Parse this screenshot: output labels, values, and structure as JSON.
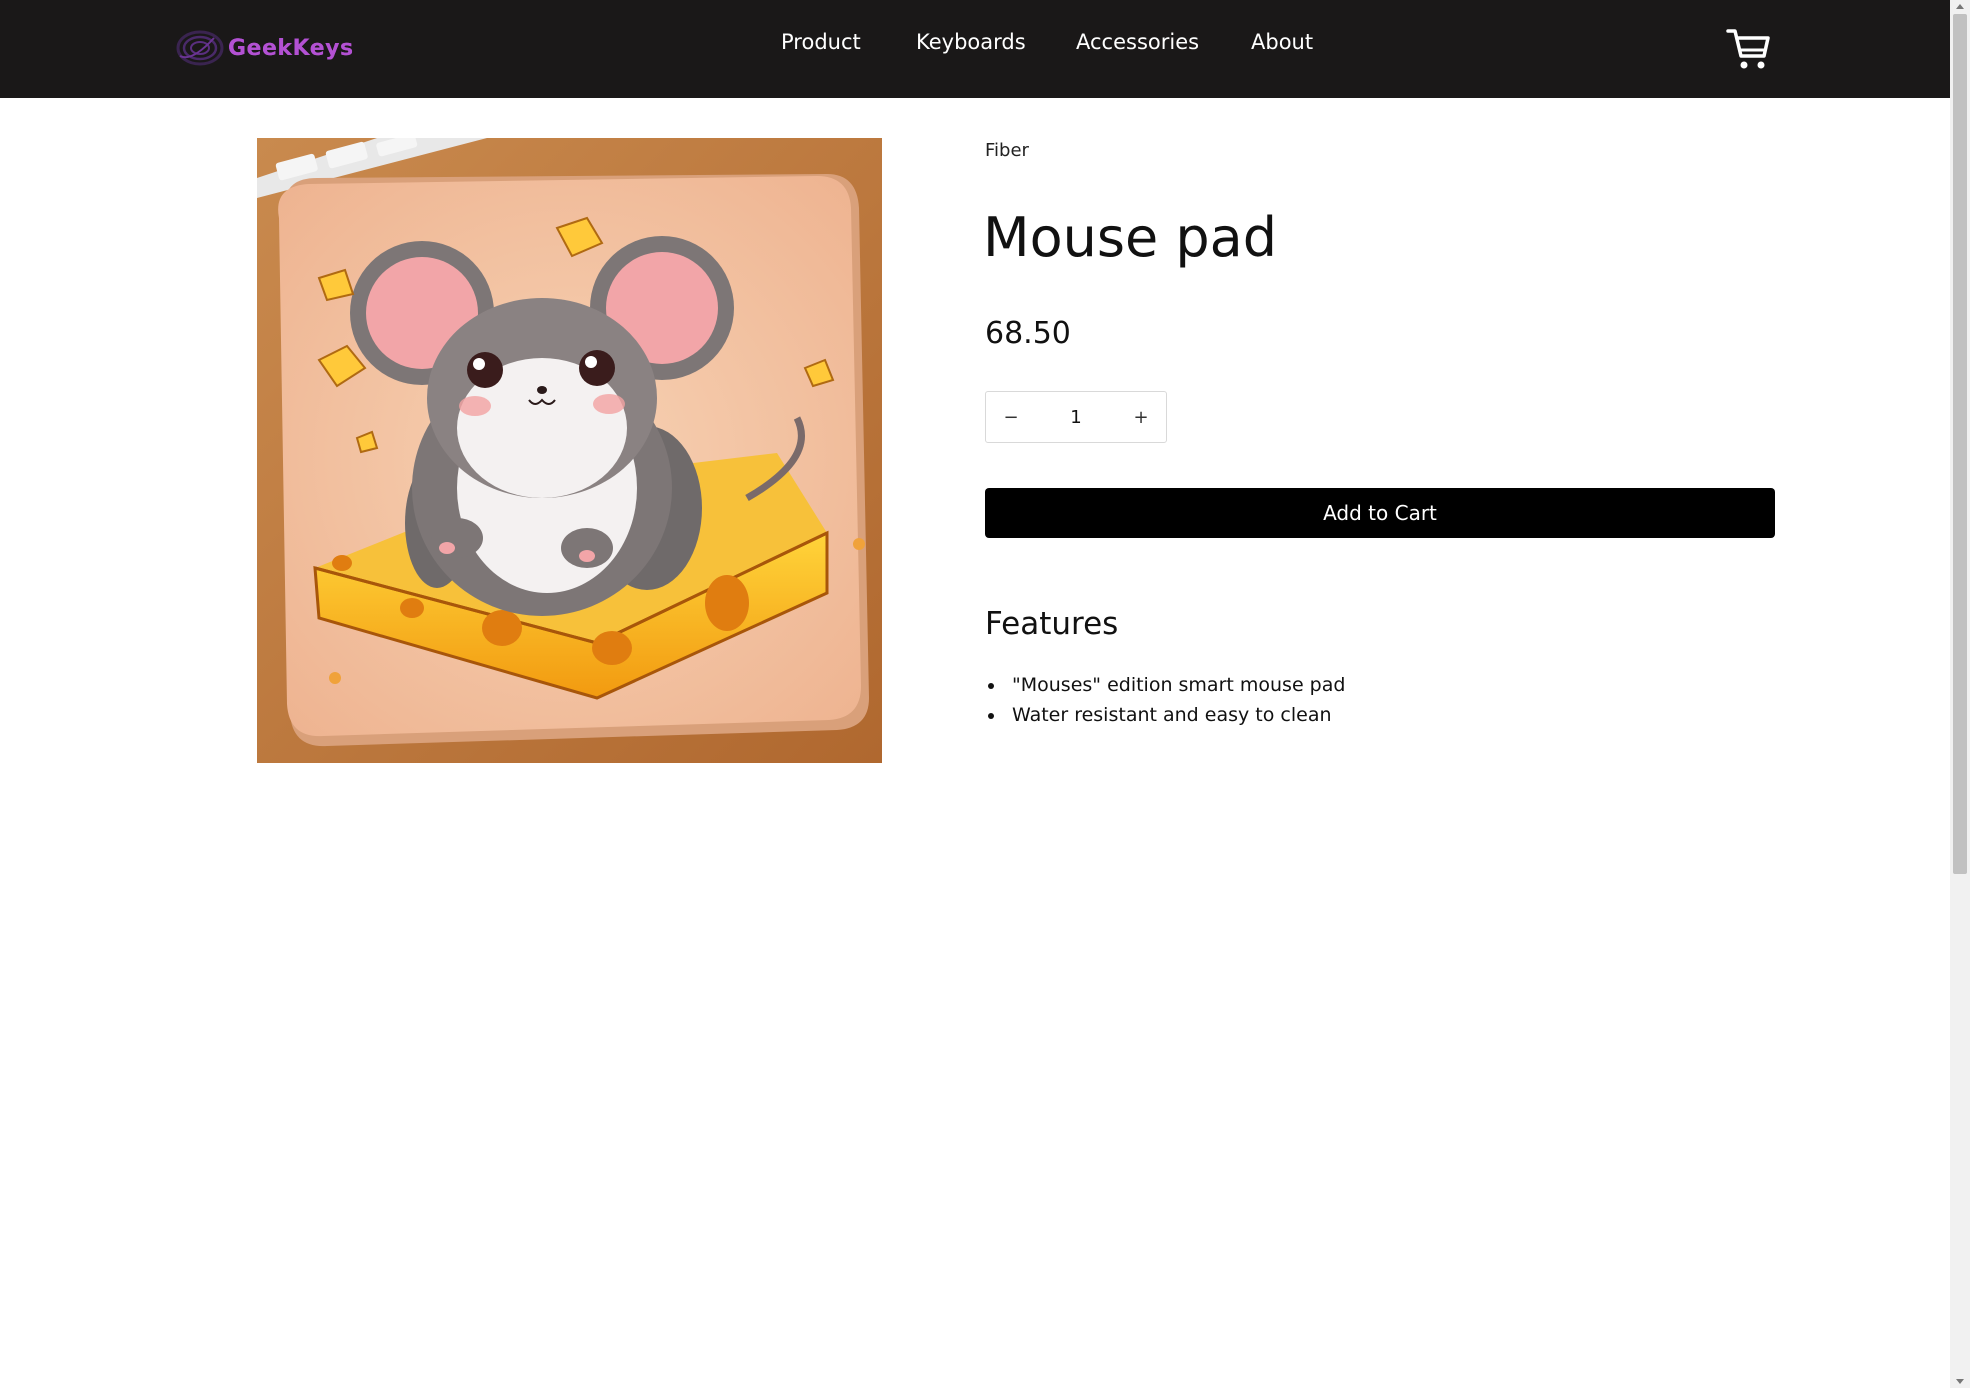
{
  "header": {
    "logo_text": "GeekKeys",
    "nav": [
      {
        "label": "Product"
      },
      {
        "label": "Keyboards"
      },
      {
        "label": "Accessories"
      },
      {
        "label": "About"
      }
    ],
    "cart_icon": "shopping-cart-icon",
    "background": "#1a1818"
  },
  "product": {
    "brand": "Fiber",
    "title": "Mouse pad",
    "price": "68.50",
    "quantity": {
      "value": "1",
      "decrement_label": "−",
      "increment_label": "+"
    },
    "add_to_cart_label": "Add to Cart",
    "features": {
      "heading": "Features",
      "items": [
        "\"Mouses\" edition smart mouse pad",
        "Water resistant and easy to clean"
      ]
    }
  }
}
